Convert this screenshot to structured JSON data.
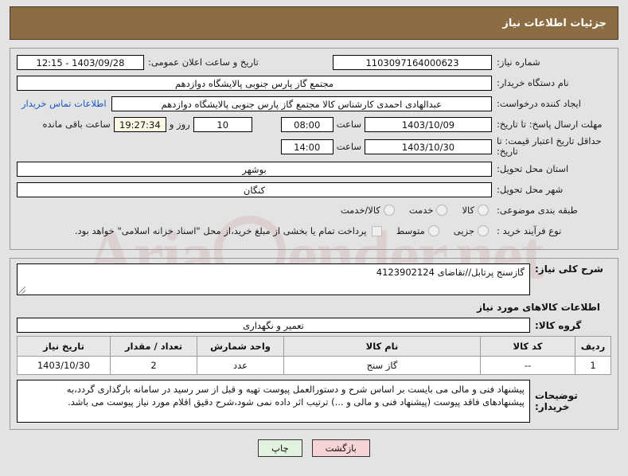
{
  "header": {
    "title": "جزئیات اطلاعات نیاز"
  },
  "form": {
    "labels": {
      "need_number": "شماره نیاز:",
      "buyer_org": "نام دستگاه خریدار:",
      "requester": "ایجاد کننده درخواست:",
      "response_deadline": "مهلت ارسال پاسخ: تا تاریخ:",
      "price_validity": "حداقل تاریخ اعتبار قیمت: تا تاریخ:",
      "delivery_province": "استان محل تحویل:",
      "delivery_city": "شهر محل تحویل:",
      "subject_category": "طبقه بندی موضوعی:",
      "purchase_process_type": "نوع فرآیند خرید :",
      "public_announce_datetime": "تاریخ و ساعت اعلان عمومی:",
      "hour": "ساعت",
      "day_and": "روز و",
      "remaining_hours": "ساعت باقی مانده"
    },
    "values": {
      "need_number": "1103097164000623",
      "public_announce_datetime": "1403/09/28 - 12:15",
      "buyer_org": "مجتمع گاز پارس جنوبی  پالایشگاه دوازدهم",
      "requester": "عبدالهادی احمدی کارشناس کالا مجتمع گاز پارس جنوبی  پالایشگاه دوازدهم",
      "buyer_contact_link": "اطلاعات تماس خریدار",
      "response_deadline_date": "1403/10/09",
      "response_deadline_time": "08:00",
      "remaining_days": "10",
      "remaining_clock": "19:27:34",
      "price_validity_date": "1403/10/30",
      "price_validity_time": "14:00",
      "delivery_province": "بوشهر",
      "delivery_city": "کنگان"
    },
    "subject_options": [
      {
        "label": "کالا",
        "selected": false
      },
      {
        "label": "خدمت",
        "selected": false
      },
      {
        "label": "کالا/خدمت",
        "selected": false
      }
    ],
    "process_options": [
      {
        "label": "جزیی",
        "selected": false
      },
      {
        "label": "متوسط",
        "selected": false
      }
    ],
    "treasury_checkbox": {
      "checked": false,
      "label": "پرداخت تمام یا بخشی از مبلغ خرید،از محل \"اسناد خزانه اسلامی\" خواهد بود."
    }
  },
  "description": {
    "label": "شرح کلی نیاز:",
    "value": "گازسنج پرتابل//تقاضای 4123902124"
  },
  "goods_section": {
    "heading": "اطلاعات کالاهای مورد نیاز",
    "group_label": "گروه کالا:",
    "group_value": "تعمیر و نگهداری",
    "table": {
      "columns": [
        "ردیف",
        "کد کالا",
        "نام کالا",
        "واحد شمارش",
        "تعداد / مقدار",
        "تاریخ نیاز"
      ],
      "rows": [
        [
          "1",
          "--",
          "گاز سنج",
          "عدد",
          "2",
          "1403/10/30"
        ]
      ]
    }
  },
  "buyer_notes": {
    "label": "توضیحات خریدار:",
    "value": "پیشنهاد فنی و مالی می بایست بر اساس شرح و دستورالعمل پیوست تهیه و قبل از سر رسید در سامانه بارگذاری گردد،به پیشنهادهای فاقد پیوست (پیشنهاد فنی و مالی و ...) ترتیب اثر داده نمی شود،شرح دقیق اقلام مورد نیاز پیوست می باشد."
  },
  "footer": {
    "back_label": "بازگشت",
    "print_label": "چاپ"
  },
  "watermark": {
    "text_left": "Aria",
    "text_right": "ender.net"
  },
  "colors": {
    "header_bg": "#8c6d43",
    "page_bg": "#e3e3e3",
    "link": "#1958c8",
    "back_btn": "#f6d4d6",
    "print_btn": "#e2f3e0",
    "timer_bg": "#fbf9e6"
  }
}
